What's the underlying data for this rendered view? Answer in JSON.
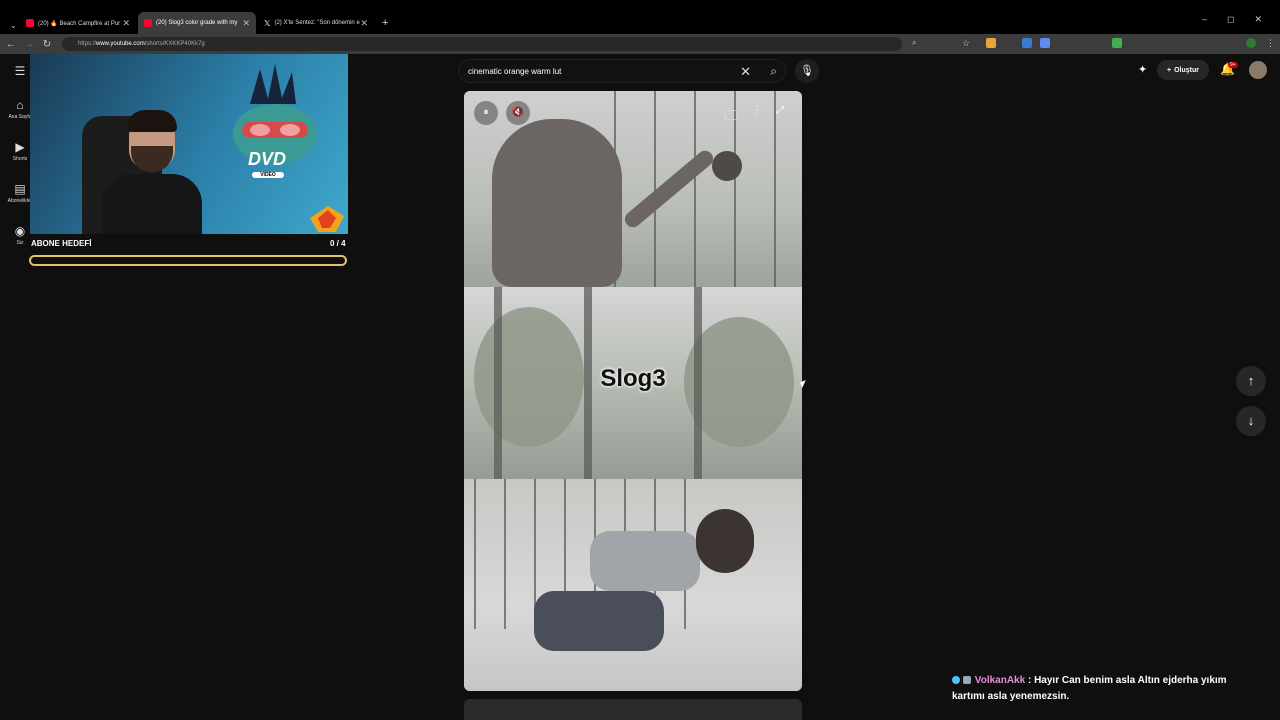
{
  "browser": {
    "tabs": [
      {
        "label": "(20) 🔥 Beach Campfire at Pur",
        "favicon_color": "#ff0033",
        "active": false
      },
      {
        "label": "(20) Slog3 color grade with my",
        "favicon_color": "#ff0033",
        "active": true
      },
      {
        "label": "(2) X'te Sentez: \"Son dönemin e",
        "favicon_color": "#ffffff",
        "active": false
      }
    ],
    "new_tab": "+",
    "url": {
      "prefix": "https://",
      "domain": "www.youtube.com",
      "path": "/shorts/KXKKP40Kk7g"
    },
    "window_controls": [
      "–",
      "◻",
      "✕"
    ]
  },
  "youtube": {
    "sidebar": [
      {
        "label": "Ana Sayfa",
        "icon": "home-icon"
      },
      {
        "label": "Shorts",
        "icon": "shorts-icon"
      },
      {
        "label": "Abonelikler",
        "icon": "subscriptions-icon"
      },
      {
        "label": "Siz",
        "icon": "user-icon"
      }
    ],
    "search": {
      "value": "cinematic orange warm lut",
      "clear": "✕",
      "submit": "⌕",
      "mic": "🎙"
    },
    "header": {
      "create_label": "Oluştur",
      "create_plus": "+",
      "notifications_badge": "9+"
    },
    "short": {
      "overlay_text": "Slog3",
      "controls": {
        "pause": "⏸",
        "mute": "🔇",
        "more": "⋮",
        "fullscreen": "⤢"
      }
    },
    "nav": {
      "up": "↑",
      "down": "↓"
    }
  },
  "stream_overlay": {
    "goal_title": "ABONE HEDEFİ",
    "goal_count": "0 / 4",
    "goal_progress": 0.0,
    "goal_color": "#e2c16a",
    "dvd_text": "DVD",
    "dvd_sub": "VIDEO"
  },
  "chat": {
    "user": "VolkanAkk",
    "separator": ":",
    "message": "Hayır Can benim asla Altın ejderha yıkım kartımı asla yenemezsin.",
    "user_color": "#e48ed8"
  }
}
